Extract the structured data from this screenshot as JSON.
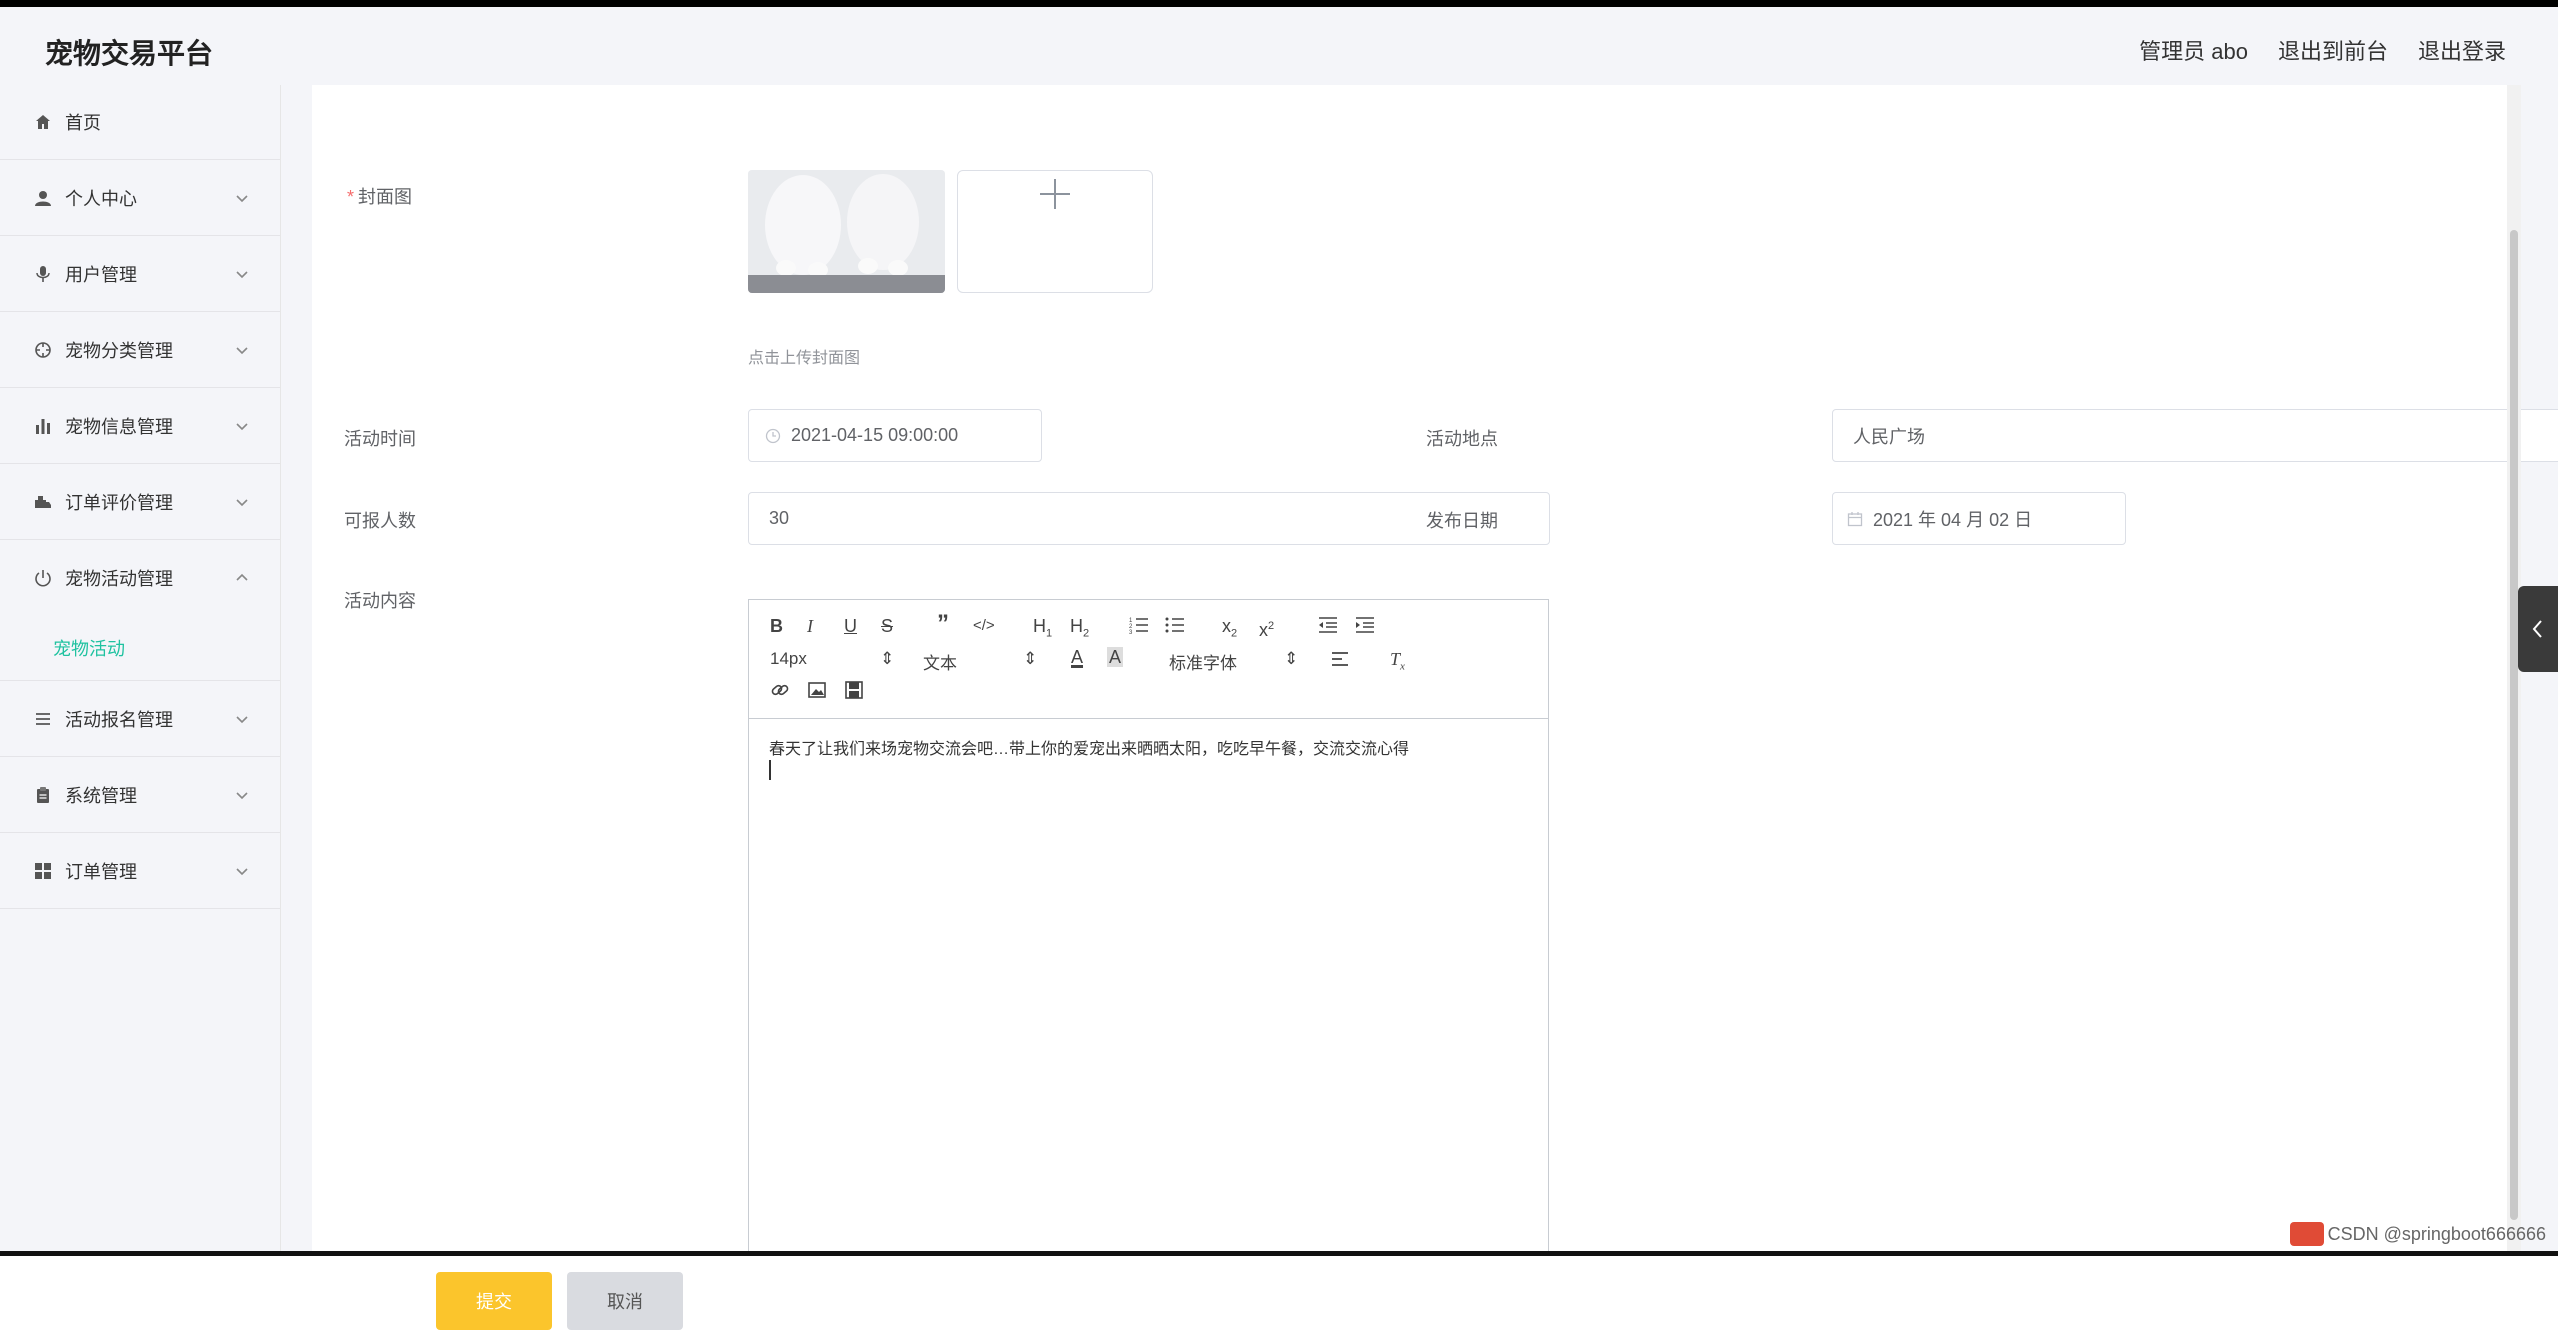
{
  "app": {
    "title": "宠物交易平台"
  },
  "header": {
    "links": [
      "管理员 abo",
      "退出到前台",
      "退出登录"
    ]
  },
  "sidebar": {
    "items": [
      {
        "label": "首页",
        "icon": "home-icon"
      },
      {
        "label": "个人中心",
        "icon": "user-icon"
      },
      {
        "label": "用户管理",
        "icon": "microphone-icon"
      },
      {
        "label": "宠物分类管理",
        "icon": "compass-icon"
      },
      {
        "label": "宠物信息管理",
        "icon": "bar-chart-icon"
      },
      {
        "label": "订单评价管理",
        "icon": "truck-icon"
      },
      {
        "label": "宠物活动管理",
        "icon": "power-icon",
        "expanded": true,
        "children": [
          "宠物活动"
        ]
      },
      {
        "label": "活动报名管理",
        "icon": "list-icon"
      },
      {
        "label": "系统管理",
        "icon": "clipboard-icon"
      },
      {
        "label": "订单管理",
        "icon": "grid-icon"
      }
    ],
    "accent": "#1fc2a0"
  },
  "form": {
    "cover_label": "封面图",
    "cover_hint": "点击上传封面图",
    "activity_time_label": "活动时间",
    "activity_time_value": "2021-04-15 09:00:00",
    "location_label": "活动地点",
    "location_value": "人民广场",
    "capacity_label": "可报人数",
    "capacity_value": "30",
    "publish_date_label": "发布日期",
    "publish_date_value": "2021 年 04 月 02 日",
    "content_label": "活动内容",
    "content_text": "春天了让我们来场宠物交流会吧…带上你的爱宠出来晒晒太阳，吃吃早午餐，交流交流心得",
    "submit_label": "提交",
    "cancel_label": "取消"
  },
  "editor_toolbar": {
    "size_select": "14px",
    "header_select": "文本",
    "font_select": "标准字体"
  },
  "watermark": "CSDN @springboot666666",
  "colors": {
    "submit": "#fbc52c",
    "cancel": "#d9dbe0"
  }
}
